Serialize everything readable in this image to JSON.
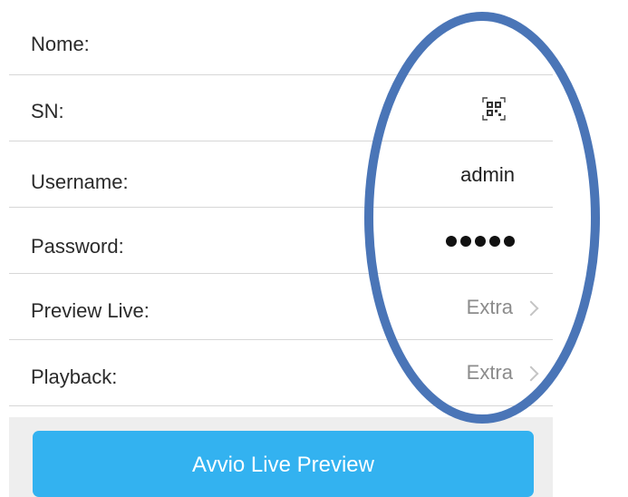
{
  "form": {
    "rows": [
      {
        "label": "Nome:",
        "value": ""
      },
      {
        "label": "SN:",
        "icon": "qr-code-icon"
      },
      {
        "label": "Username:",
        "value": "admin"
      },
      {
        "label": "Password:",
        "value": "•••••"
      },
      {
        "label": "Preview Live:",
        "value": "Extra",
        "icon": "chevron-right-icon"
      },
      {
        "label": "Playback:",
        "value": "Extra",
        "icon": "chevron-right-icon"
      }
    ]
  },
  "button": {
    "label": "Avvio Live Preview"
  },
  "colors": {
    "button_bg": "#33b2f0",
    "annotation_ellipse": "#4a75b7"
  }
}
